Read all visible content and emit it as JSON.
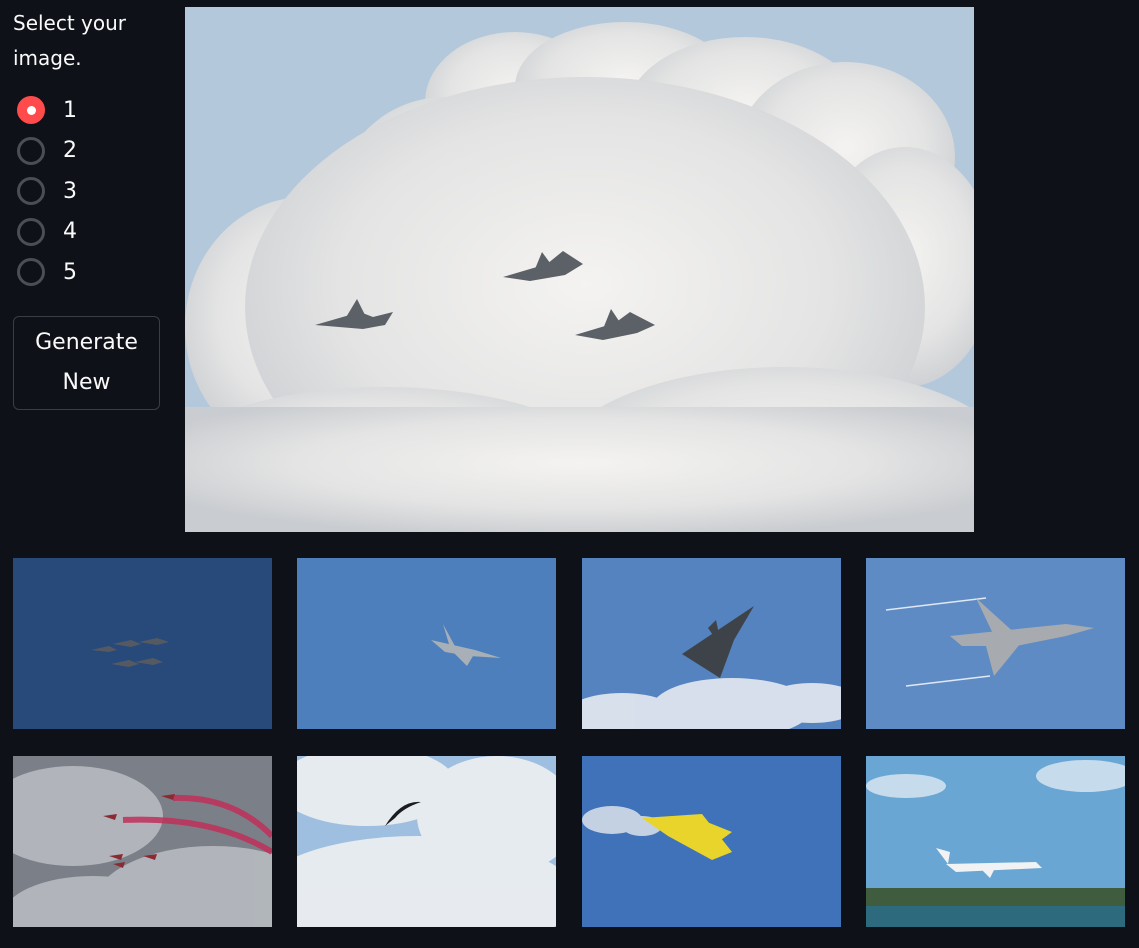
{
  "sidebar": {
    "prompt": "Select your image.",
    "options": [
      "1",
      "2",
      "3",
      "4",
      "5"
    ],
    "selected": "1",
    "accent_color": "#ff4b4b",
    "button_label_line1": "Generate",
    "button_label_line2": "New"
  },
  "main_image": {
    "subject": "three jets flying in front of white cumulus clouds"
  },
  "gallery": [
    {
      "subject": "jet formation against dark blue sky"
    },
    {
      "subject": "fighter jet against blue sky"
    },
    {
      "subject": "delta-wing jet banking above clouds"
    },
    {
      "subject": "grey fighter jet with vapor trails"
    },
    {
      "subject": "red arrows formation with red smoke under cloudy sky"
    },
    {
      "subject": "swift bird silhouette against cloudy sky"
    },
    {
      "subject": "yellow aerobatic plane with smoke"
    },
    {
      "subject": "airliner landing over water"
    }
  ],
  "colors": {
    "background": "#0e1117",
    "text": "#fafafa",
    "radio_border": "#4b4e57"
  }
}
